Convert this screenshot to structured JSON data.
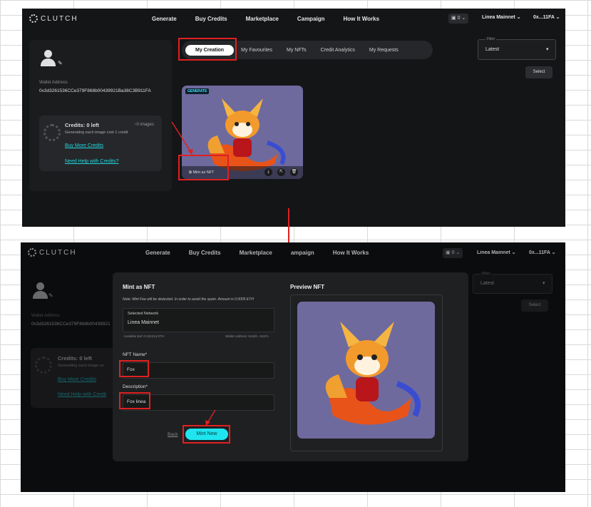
{
  "brand": "CLUTCH",
  "nav": {
    "items": [
      "Generate",
      "Buy Credits",
      "Marketplace",
      "Campaign",
      "How It Works"
    ],
    "items2": [
      "Generate",
      "Buy Credits",
      "Marketplace",
      "ampaign",
      "How It Works"
    ],
    "credits_count": "0",
    "network": "Linea Mainnet",
    "account": "0x...11FA"
  },
  "profile": {
    "wallet_label": "Wallet Address",
    "wallet_address": "0x3d3261536CCe379F868b00439921Ba38C3B911FA",
    "wallet_address_2": "0x3d3261536CCe379F868b00439921",
    "credits_title": "Credits: 0 left",
    "credits_images": "~0 images",
    "credits_note": "Generating each image cost 1 credit",
    "credits_note_2": "Generating each image co",
    "buy_link": "Buy More Credits",
    "help_link": "Need Help with Credits?",
    "help_link_2": "Need Help with Credit"
  },
  "tabs": [
    "My Creation",
    "My Favourites",
    "My NFTs",
    "Credit Analytics",
    "My Requests"
  ],
  "filter": {
    "label": "Filter",
    "value": "Latest",
    "select_button": "Select"
  },
  "card": {
    "badge": "GENERATE",
    "mint_label": "Mint as NFT"
  },
  "modal": {
    "title": "Mint as NFT",
    "note": "Note: Mint Fee will be deducted. In order to avoid the spam. Amount is 0.0005 ETH",
    "network_label": "Selected Network",
    "network_value": "Linea Mainnet",
    "balance": "Available Bal: 0.034316 ETH",
    "wallet_short": "Wallet Address: 0x3d3...911FA",
    "name_label": "NFT Name*",
    "name_value": "Fox",
    "desc_label": "Description*",
    "desc_value": "Fox linea",
    "back": "Back",
    "mint_button": "Mint Now",
    "preview_title": "Preview NFT"
  },
  "colors": {
    "accent": "#1fe5ef",
    "annotation": "#e02020",
    "card_bg": "#6e6a9e"
  }
}
